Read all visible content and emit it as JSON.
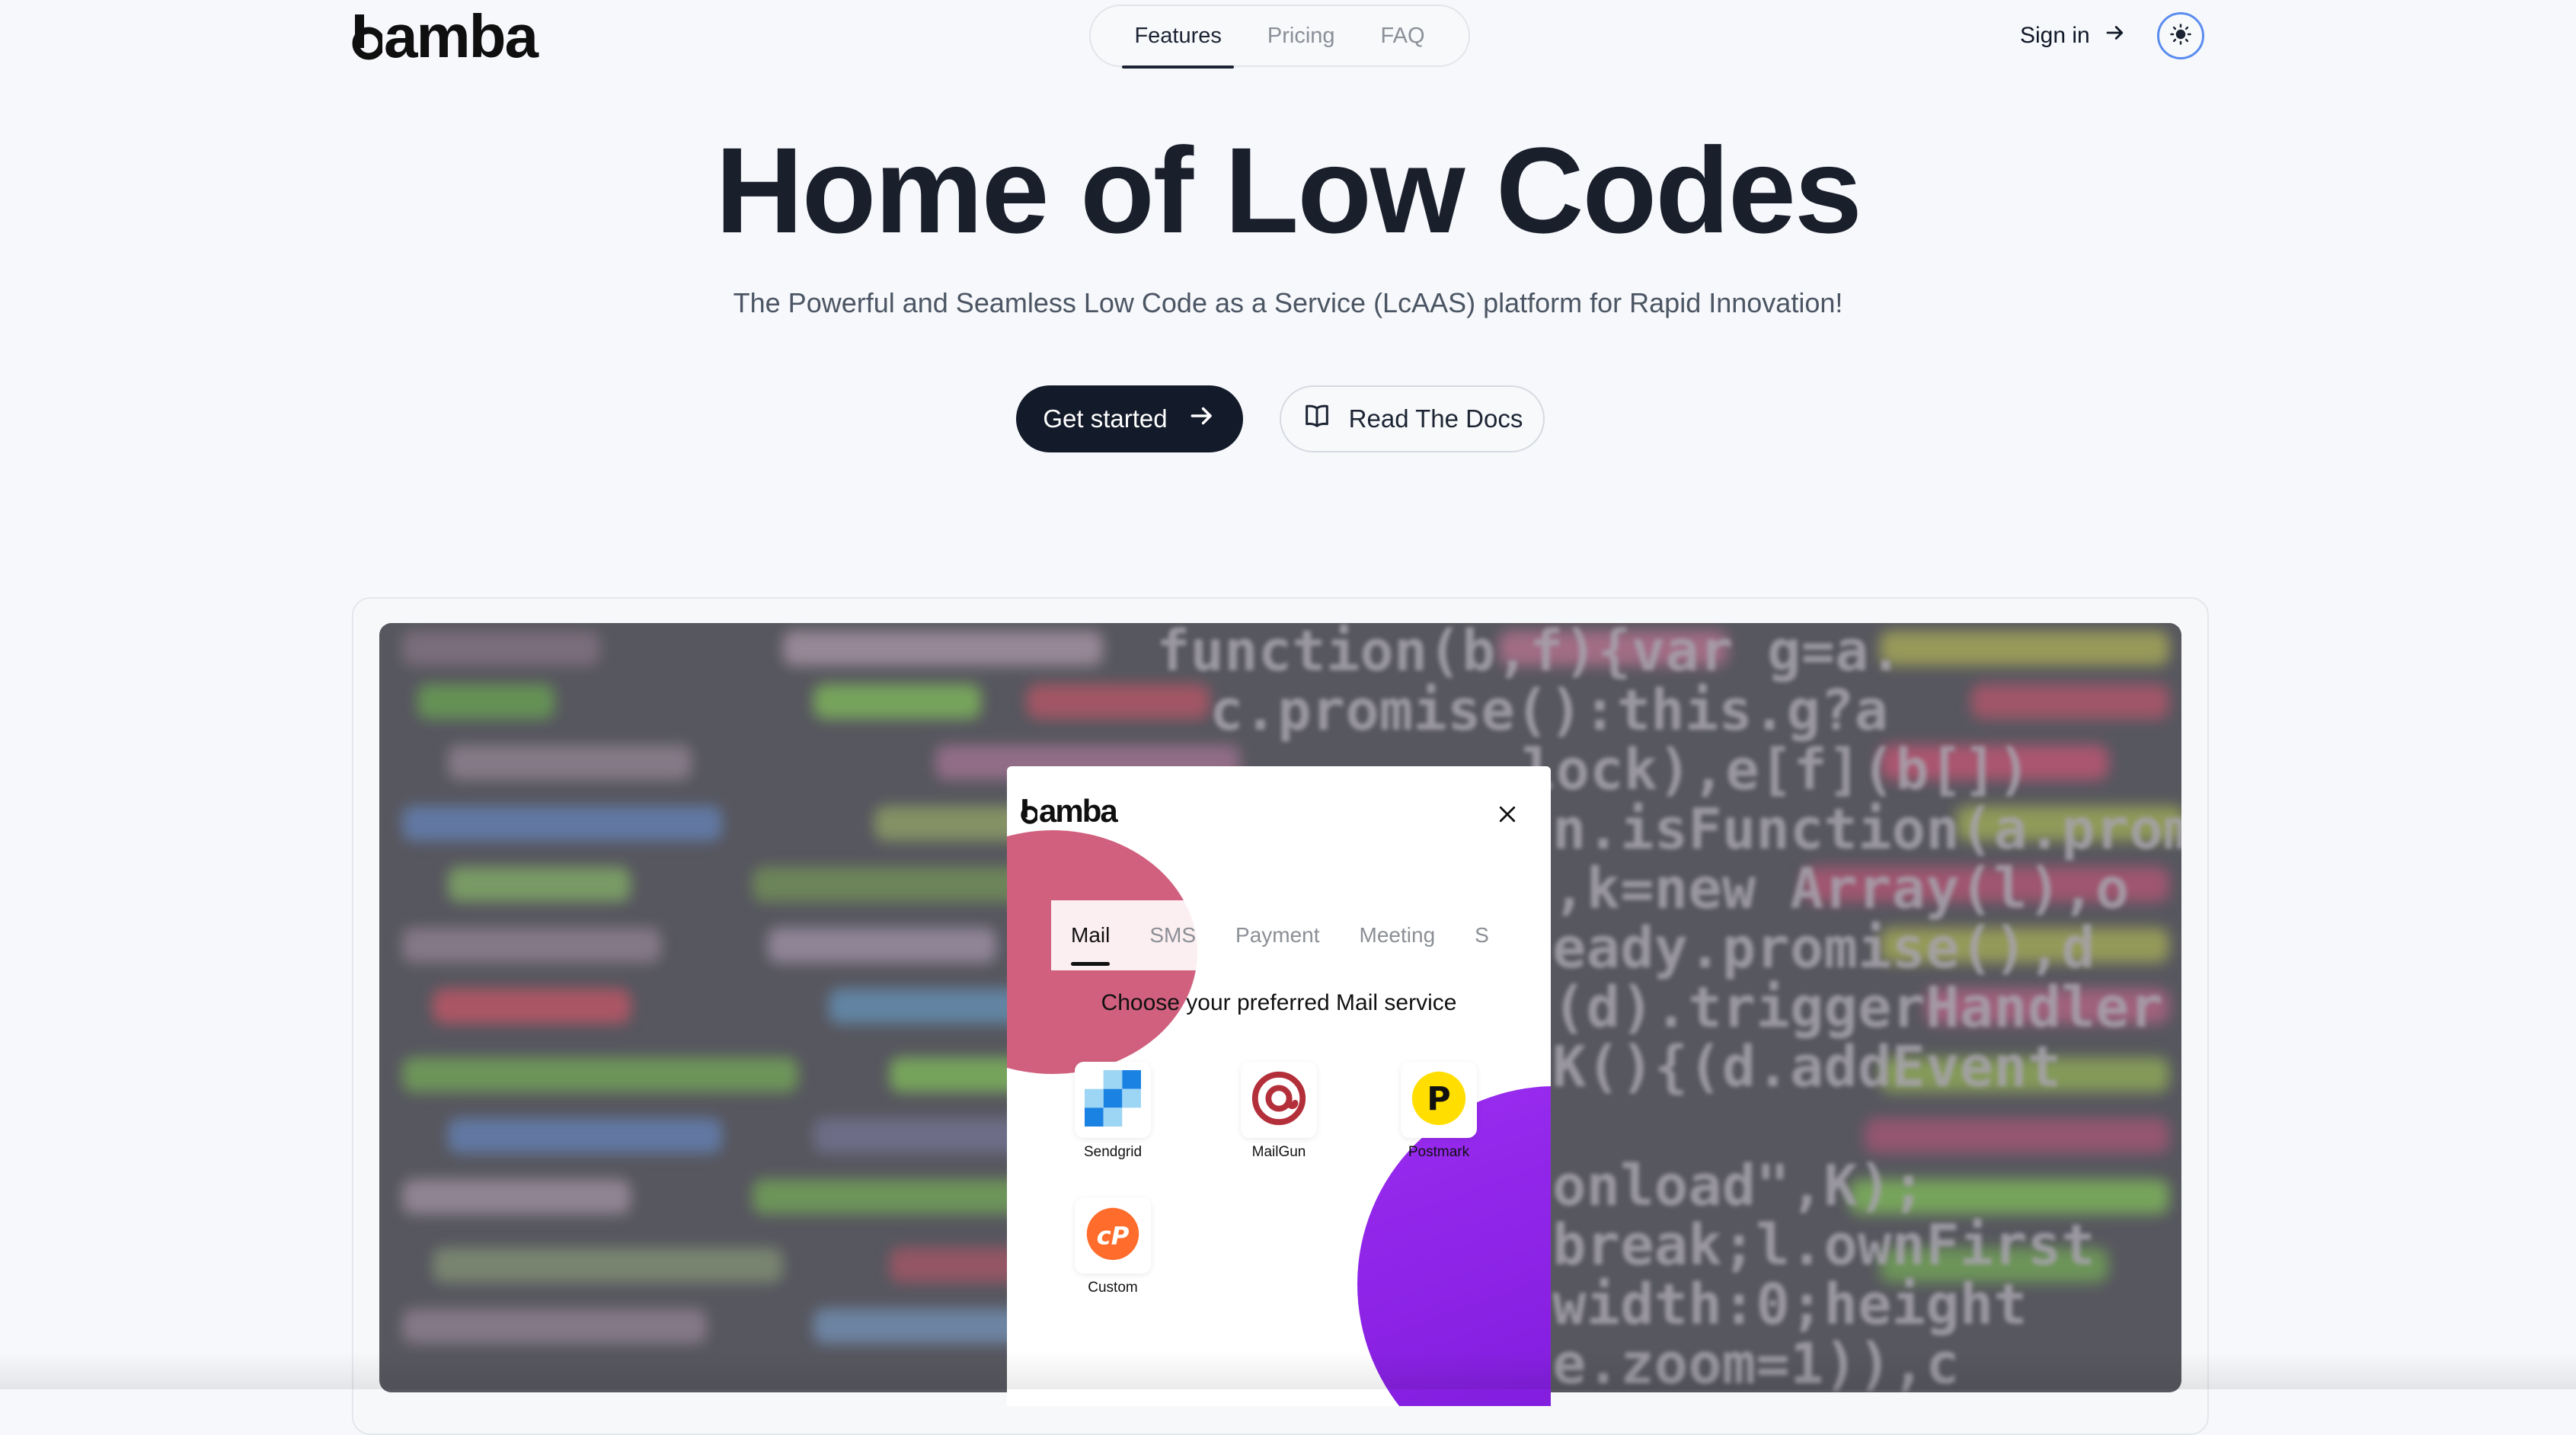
{
  "header": {
    "brand": "amba",
    "nav": [
      {
        "label": "Features",
        "active": true
      },
      {
        "label": "Pricing",
        "active": false
      },
      {
        "label": "FAQ",
        "active": false
      }
    ],
    "sign_in": "Sign in",
    "theme_icon": "sun-icon"
  },
  "hero": {
    "title": "Home of Low Codes",
    "subtitle": "The Powerful and Seamless Low Code as a Service (LcAAS) platform for Rapid Innovation!",
    "primary_button": "Get started",
    "secondary_button": "Read The Docs"
  },
  "showcase": {
    "background_code": [
      "function(b,f){var g=a.",
      "c.promise():this.g?a",
      "lock),e[f](b[])",
      "n.isFunction(a.promise",
      ",k=new Array(l),o",
      "eady.promise(),d",
      "(d).triggerHandler",
      "K(){(d.addEvent",
      "onload\",K);",
      "break;l.ownFirst",
      "width:0;height",
      "e.zoom=1)),c"
    ],
    "modal": {
      "brand": "amba",
      "tabs": [
        {
          "label": "Mail",
          "active": true
        },
        {
          "label": "SMS",
          "active": false
        },
        {
          "label": "Payment",
          "active": false
        },
        {
          "label": "Meeting",
          "active": false
        },
        {
          "label": "S",
          "active": false
        }
      ],
      "prompt": "Choose your preferred Mail service",
      "services": [
        {
          "label": "Sendgrid",
          "icon": "sendgrid-icon"
        },
        {
          "label": "MailGun",
          "icon": "mailgun-icon"
        },
        {
          "label": "Postmark",
          "icon": "postmark-icon"
        },
        {
          "label": "Custom",
          "icon": "cpanel-icon"
        }
      ]
    }
  },
  "colors": {
    "background": "#f6f8fb",
    "primary_button": "#131a29",
    "accent_blue": "#5b8def",
    "blob_pink": "#d0607e",
    "blob_purple": "#8a22e6"
  }
}
